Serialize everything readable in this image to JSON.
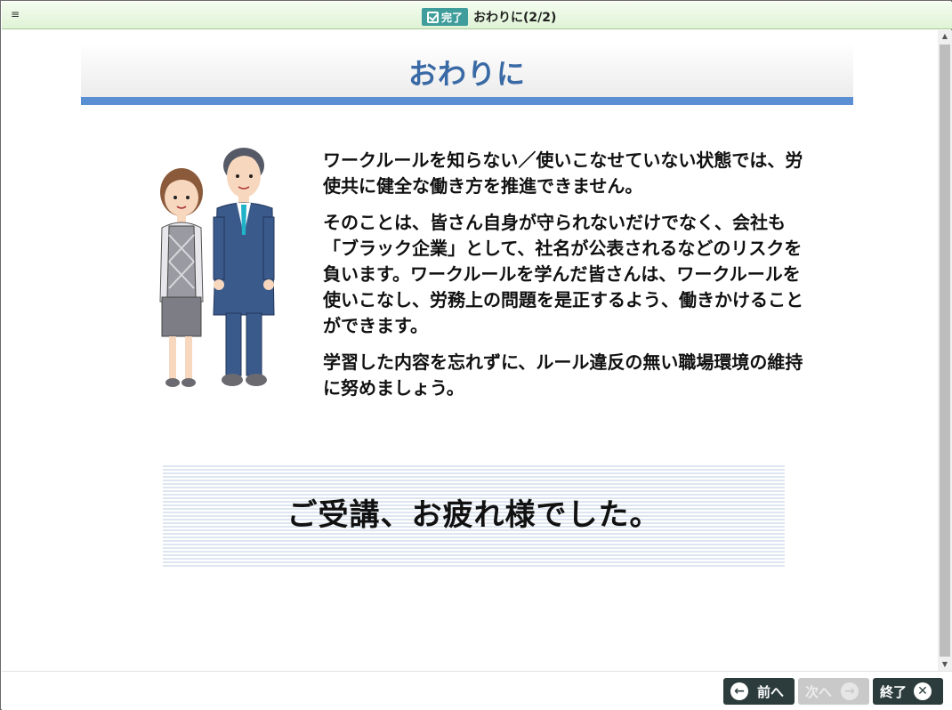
{
  "titlebar": {
    "menu_icon": "≡",
    "done_badge": "完了",
    "title": "おわりに(2/2)"
  },
  "content": {
    "page_title": "おわりに",
    "paragraphs": [
      "ワークルールを知らない／使いこなせていない状態では、労使共に健全な働き方を推進できません。",
      "そのことは、皆さん自身が守られないだけでなく、会社も「ブラック企業」として、社名が公表されるなどのリスクを負います。ワークルールを学んだ皆さんは、ワークルールを使いこなし、労務上の問題を是正するよう、働きかけることができます。",
      "学習した内容を忘れずに、ルール違反の無い職場環境の維持に努めましょう。"
    ],
    "thanks": "ご受講、お疲れ様でした。"
  },
  "footer": {
    "prev_label": "前へ",
    "next_label": "次へ",
    "end_label": "終了"
  },
  "colors": {
    "accent_blue": "#5b8fd4",
    "title_blue": "#3a6aa5",
    "badge_teal": "#3f9e9b",
    "button_dark": "#2c3b3b"
  },
  "icons": {
    "menu": "menu-icon",
    "done": "checkbox-icon",
    "prev": "arrow-left-icon",
    "next": "arrow-right-icon",
    "end": "close-icon"
  }
}
